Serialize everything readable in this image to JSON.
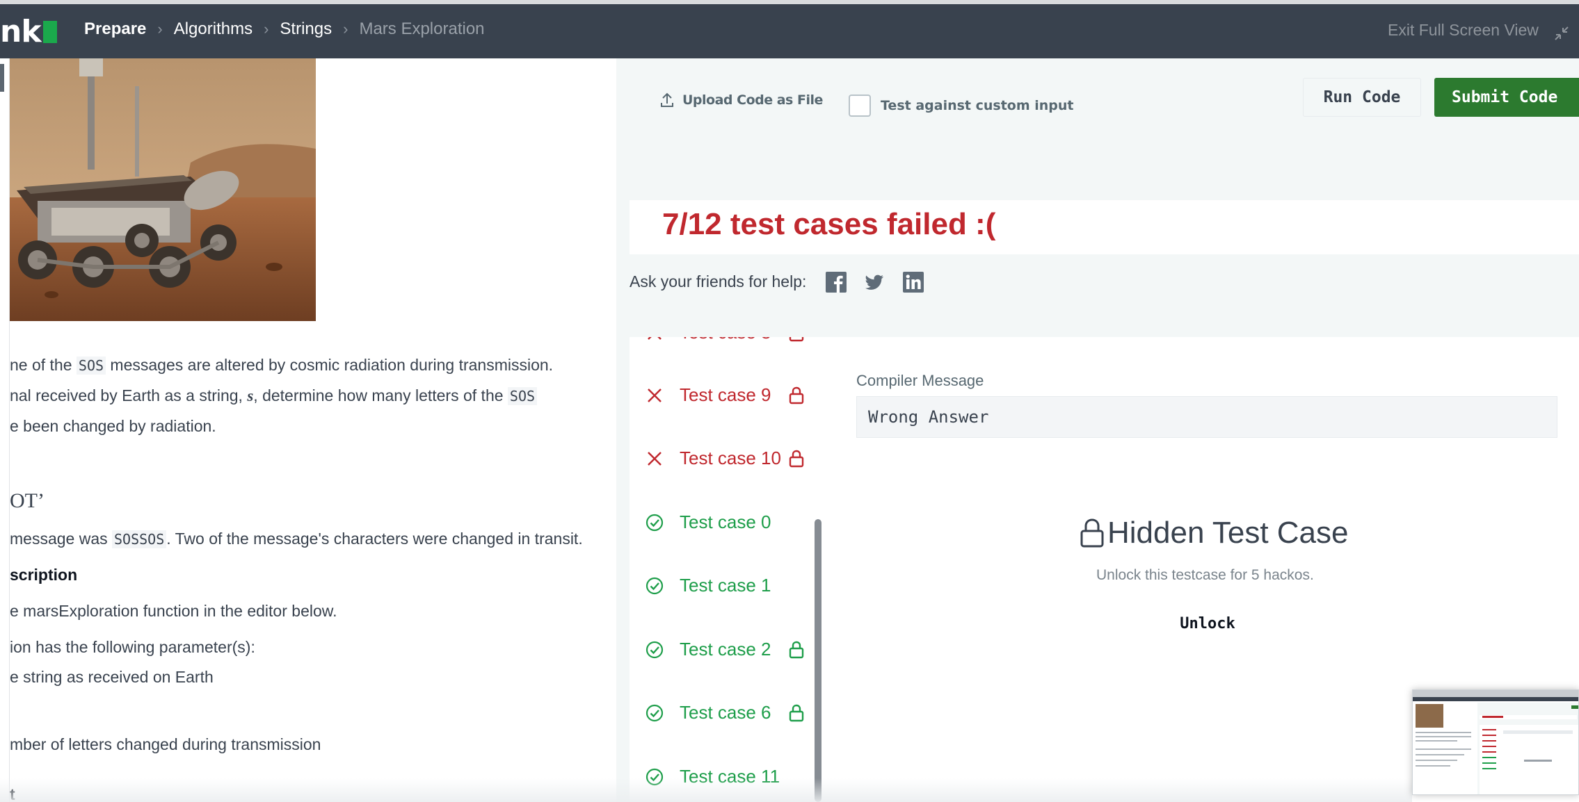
{
  "header": {
    "logo_text": "nk",
    "breadcrumb": [
      "Prepare",
      "Algorithms",
      "Strings",
      "Mars Exploration"
    ],
    "exit_full_screen": "Exit Full Screen View"
  },
  "problem": {
    "line1_pre": "ne of the ",
    "line1_code": "SOS",
    "line1_post": " messages are altered by cosmic radiation during transmission.",
    "line2_pre": "nal received by Earth as a string, ",
    "line2_var": "s",
    "line2_mid": ", determine how many letters of the ",
    "line2_code": "SOS",
    "line3": "e been changed by radiation.",
    "example_heading": "OT’",
    "example_pre": "message was ",
    "example_code": "SOSSOS",
    "example_post": ". Two of the message's characters were changed in transit.",
    "function_desc_heading": "scription",
    "function_desc": "e marsExploration function in the editor below.",
    "params_intro": "ion has the following parameter(s):",
    "param_s": "e string as received on Earth",
    "returns": "mber of letters changed during transmission",
    "next_heading": "t"
  },
  "actions": {
    "upload": "Upload Code as File",
    "custom_input": "Test against custom input",
    "run": "Run Code",
    "submit": "Submit Code"
  },
  "result": {
    "title": "7/12 test cases failed :(",
    "ask_friends": "Ask your friends for help:"
  },
  "test_cases": [
    {
      "label": "Test case 9",
      "status": "fail",
      "locked": true
    },
    {
      "label": "Test case 10",
      "status": "fail",
      "locked": true
    },
    {
      "label": "Test case 0",
      "status": "pass",
      "locked": false
    },
    {
      "label": "Test case 1",
      "status": "pass",
      "locked": false
    },
    {
      "label": "Test case 2",
      "status": "pass",
      "locked": true
    },
    {
      "label": "Test case 6",
      "status": "pass",
      "locked": true
    },
    {
      "label": "Test case 11",
      "status": "pass",
      "locked": false
    }
  ],
  "compiler": {
    "label": "Compiler Message",
    "message": "Wrong Answer"
  },
  "hidden": {
    "title": "Hidden Test Case",
    "description": "Unlock this testcase for 5 hackos.",
    "unlock": "Unlock"
  },
  "colors": {
    "header_bg": "#39424e",
    "fail": "#c0282e",
    "pass": "#1e9e4a",
    "submit_bg": "#2c7a2f",
    "panel_bg": "#f3f7f7"
  }
}
